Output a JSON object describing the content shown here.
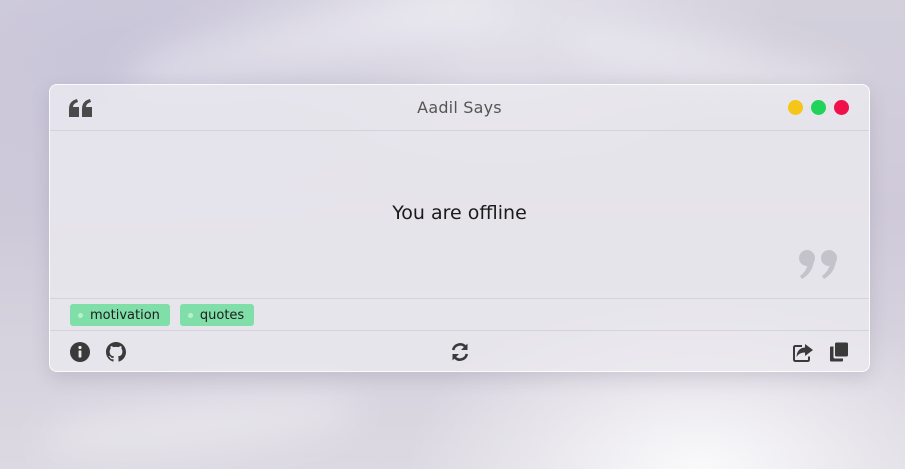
{
  "window": {
    "title": "Aadil Says",
    "controls": [
      {
        "name": "minimize",
        "color": "#f5c518"
      },
      {
        "name": "maximize",
        "color": "#22d35a"
      },
      {
        "name": "close",
        "color": "#f0114b"
      }
    ]
  },
  "quote": {
    "text": "You are offline",
    "open_icon": "quote-left-icon",
    "close_icon": "quote-right-icon"
  },
  "tags": [
    "motivation",
    "quotes"
  ],
  "colors": {
    "tag_background": "#80dea9",
    "icon": "#3a3a3a"
  },
  "footer": {
    "left": [
      "info-icon",
      "github-icon"
    ],
    "center": [
      "refresh-icon"
    ],
    "right": [
      "share-icon",
      "copy-icon"
    ]
  }
}
